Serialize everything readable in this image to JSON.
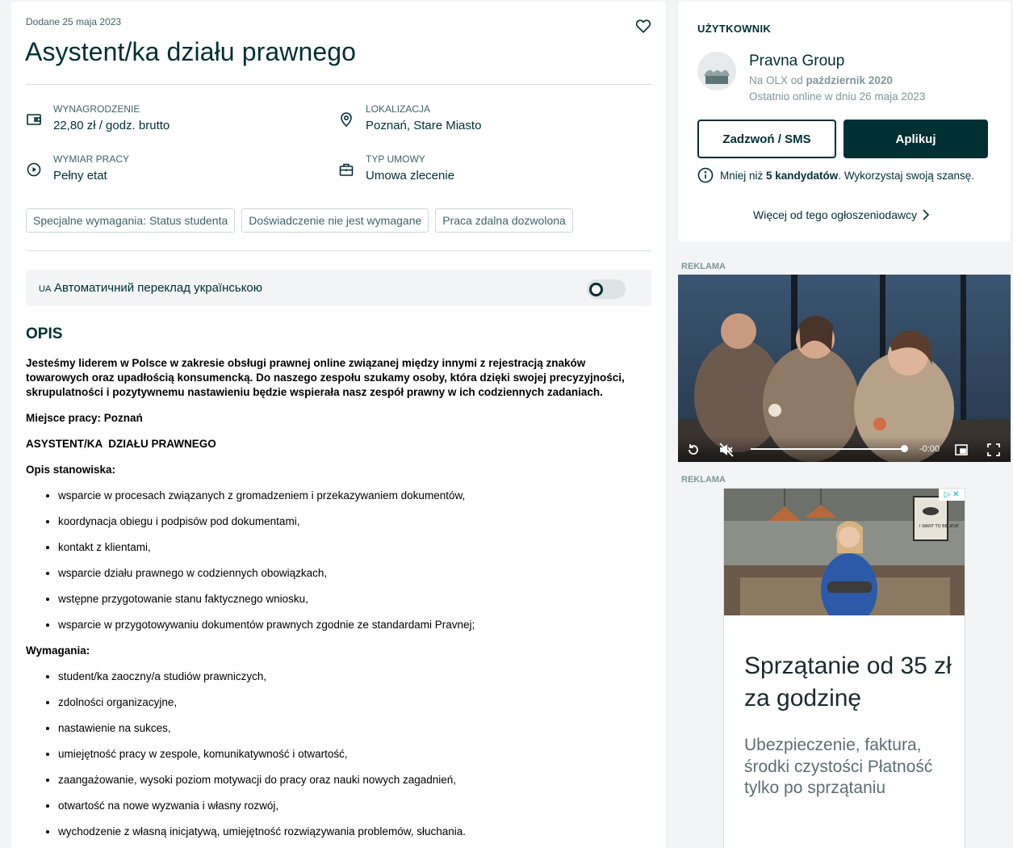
{
  "listing": {
    "date": "Dodane 25 maja 2023",
    "title": "Asystent/ka działu prawnego",
    "params": [
      {
        "label": "WYNAGRODZENIE",
        "value": "22,80 zł / godz. brutto",
        "icon": "wallet-icon"
      },
      {
        "label": "LOKALIZACJA",
        "value": "Poznań, Stare Miasto",
        "icon": "location-pin-icon"
      },
      {
        "label": "WYMIAR PRACY",
        "value": "Pełny etat",
        "icon": "clock-play-icon"
      },
      {
        "label": "TYP UMOWY",
        "value": "Umowa zlecenie",
        "icon": "briefcase-icon"
      }
    ],
    "tags": [
      "Specjalne wymagania: Status studenta",
      "Doświadczenie nie jest wymagane",
      "Praca zdalna dozwolona"
    ],
    "translate": {
      "lang": "UA",
      "text": "Автоматичний переклад українською"
    },
    "opis_heading": "OPIS",
    "intro": "Jesteśmy liderem w Polsce w zakresie obsługi prawnej online związanej między innymi z rejestracją znaków towarowych oraz upadłością konsumencką. Do naszego zespołu szukamy osoby, która dzięki swojej precyzyjności, skrupulatności i pozytywnemu nastawieniu będzie wspierała nasz zespół prawny w ich codziennych zadaniach.",
    "workplace": "Miejsce pracy: Poznań",
    "position": "ASYSTENT/KA  DZIAŁU PRAWNEGO",
    "duties_heading": "Opis stanowiska:",
    "duties": [
      "wsparcie w procesach związanych z gromadzeniem i przekazywaniem dokumentów,",
      "koordynacja obiegu i podpisów pod dokumentami,",
      "kontakt z klientami,",
      "wsparcie działu prawnego w codziennych obowiązkach,",
      "wstępne przygotowanie stanu faktycznego wniosku,",
      "wsparcie w przygotowywaniu dokumentów prawnych zgodnie ze standardami Pravnej;"
    ],
    "req_heading": "Wymagania:",
    "requirements": [
      "student/ka zaoczny/a studiów prawniczych,",
      "zdolności organizacyjne,",
      "nastawienie na sukces,",
      "umiejętność pracy w zespole, komunikatywność i otwartość,",
      "zaangażowanie, wysoki poziom motywacji do pracy oraz nauki nowych zagadnień,",
      "otwartość na nowe wyzwania i własny rozwój,",
      "wychodzenie z własną inicjatywą, umiejętność rozwiązywania problemów, słuchania."
    ]
  },
  "user": {
    "heading": "UŻYTKOWNIK",
    "name": "Pravna Group",
    "since_prefix": "Na OLX od ",
    "since_value": "październik 2020",
    "online": "Ostatnio online w dniu 26 maja 2023",
    "call_label": "Zadzwoń / SMS",
    "apply_label": "Aplikuj",
    "cand_prefix": "Mniej niż ",
    "cand_bold": "5 kandydatów",
    "cand_suffix": ". Wykorzystaj swoją szansę.",
    "more_label": "Więcej od tego ogłoszeniodawcy"
  },
  "ads": {
    "label": "REKLAMA",
    "video_time": "-0:00",
    "video_progress": 1.0,
    "ad_title": "Sprzątanie od 35 zł za godzinę",
    "ad_sub": "Ubezpieczenie, faktura, środki czystości Płatność tylko po sprzątaniu",
    "poster_text": "I WANT TO BELIEVE"
  }
}
